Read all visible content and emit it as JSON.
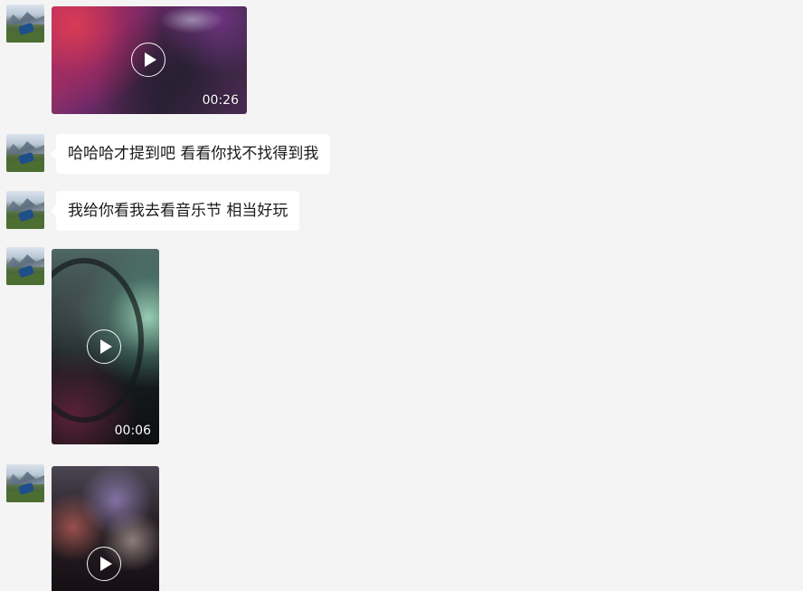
{
  "messages": [
    {
      "type": "video",
      "duration": "00:26",
      "orientation": "landscape"
    },
    {
      "type": "text",
      "text": "哈哈哈才提到吧 看看你找不找得到我"
    },
    {
      "type": "text",
      "text": "我给你看我去看音乐节 相当好玩"
    },
    {
      "type": "video",
      "duration": "00:06",
      "orientation": "portrait"
    },
    {
      "type": "video",
      "duration": "",
      "orientation": "portrait"
    }
  ],
  "colors": {
    "background": "#f4f4f4",
    "bubble": "#ffffff",
    "text": "#1a1a1a"
  },
  "icons": {
    "play": "play-icon"
  }
}
